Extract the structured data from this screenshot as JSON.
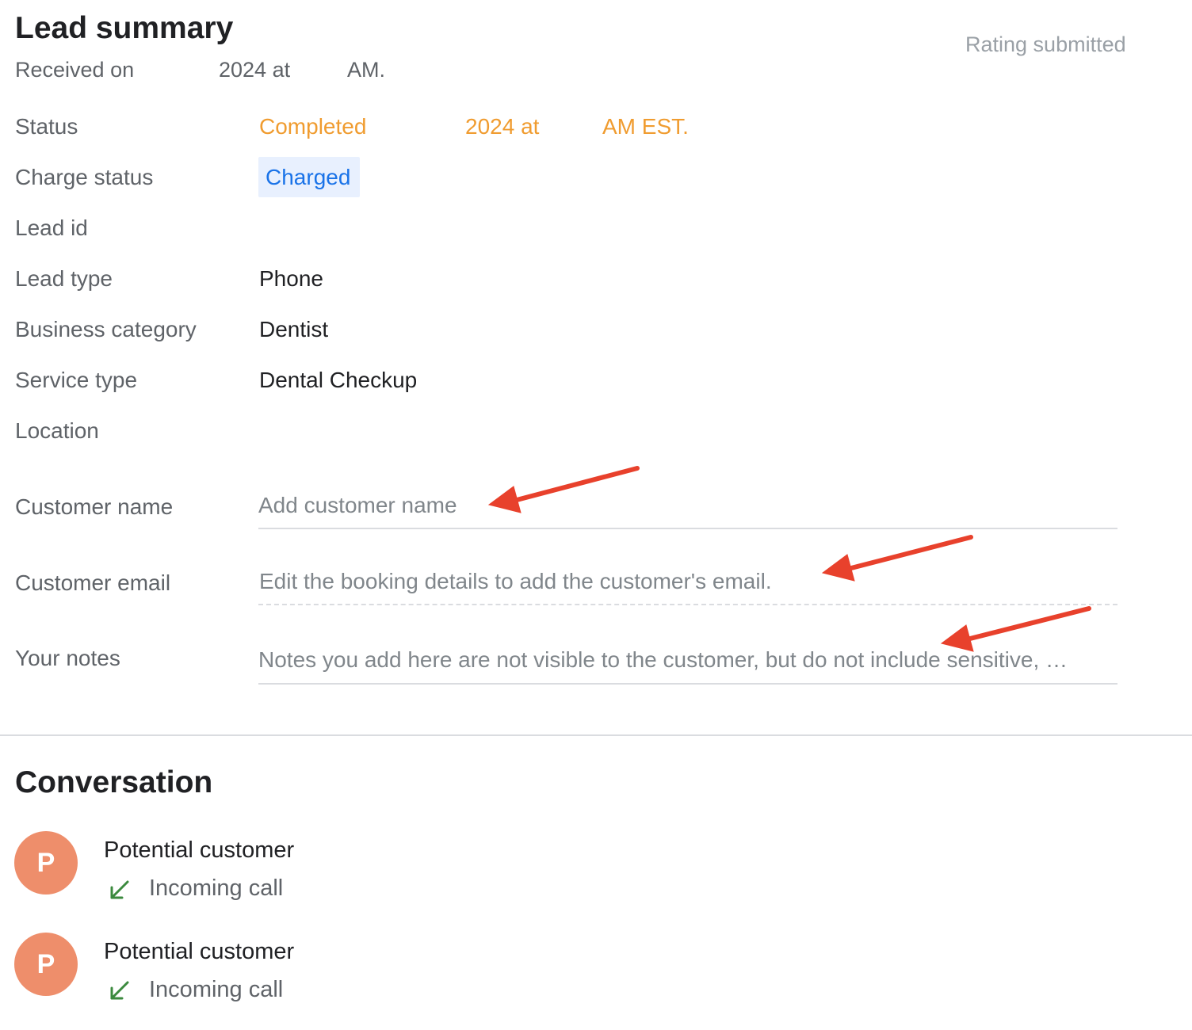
{
  "lead_summary": {
    "title": "Lead summary",
    "received_parts": [
      "Received on",
      "2024 at",
      "AM."
    ],
    "rating_status": "Rating submitted"
  },
  "details": {
    "status": {
      "label": "Status",
      "parts": [
        "Completed",
        "2024 at",
        "AM EST."
      ],
      "color": "#f09c30"
    },
    "charge_status": {
      "label": "Charge status",
      "value": "Charged",
      "chip_bg": "#e8f0fe",
      "chip_fg": "#1a73e8"
    },
    "lead_id": {
      "label": "Lead id",
      "value": ""
    },
    "lead_type": {
      "label": "Lead type",
      "value": "Phone"
    },
    "business_category": {
      "label": "Business category",
      "value": "Dentist"
    },
    "service_type": {
      "label": "Service type",
      "value": "Dental Checkup"
    },
    "location": {
      "label": "Location",
      "value": ""
    }
  },
  "fields": {
    "customer_name": {
      "label": "Customer name",
      "placeholder": "Add customer name",
      "value": ""
    },
    "customer_email": {
      "label": "Customer email",
      "placeholder": "Edit the booking details to add the customer's email."
    },
    "notes": {
      "label": "Your notes",
      "placeholder": "Notes you add here are not visible to the customer, but do not include sensitive, …",
      "value": ""
    }
  },
  "conversation": {
    "title": "Conversation",
    "entries": [
      {
        "avatar_letter": "P",
        "name": "Potential customer",
        "kind": "Incoming call",
        "icon": "incoming-call-arrow-icon"
      },
      {
        "avatar_letter": "P",
        "name": "Potential customer",
        "kind": "Incoming call",
        "icon": "incoming-call-arrow-icon"
      }
    ]
  },
  "annotations": {
    "arrow_color": "#e8412c"
  }
}
